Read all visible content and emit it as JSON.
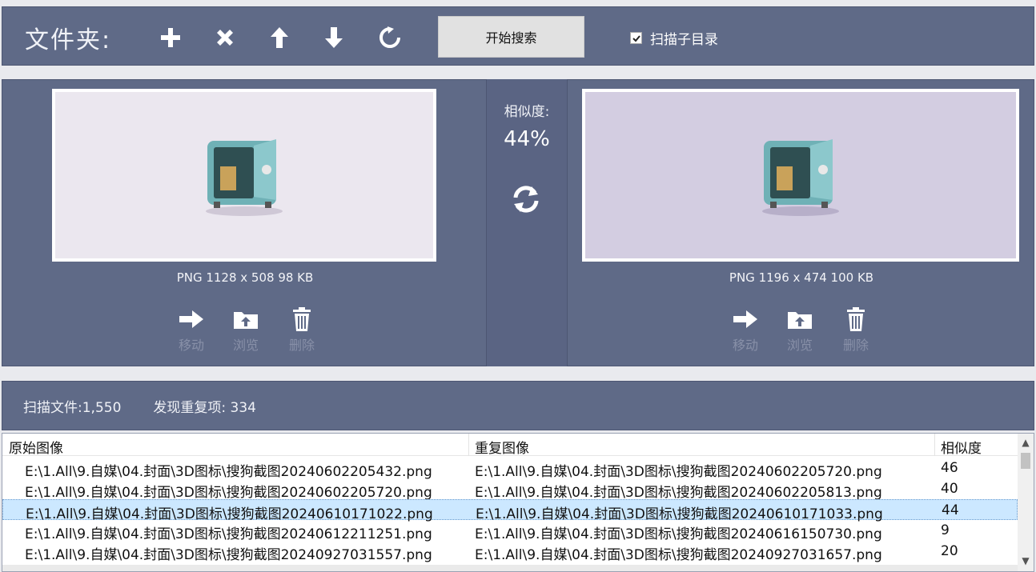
{
  "toolbar": {
    "folder_label": "文件夹:",
    "start_search_label": "开始搜索",
    "scan_subdir_label": "扫描子目录",
    "scan_subdir_checked": true,
    "icons": [
      "plus-icon",
      "close-icon",
      "arrow-up-icon",
      "arrow-down-icon",
      "refresh-icon"
    ]
  },
  "left_image": {
    "meta": "PNG  1128 x 508  98 KB",
    "actions": [
      "移动",
      "浏览",
      "删除"
    ]
  },
  "right_image": {
    "meta": "PNG  1196 x 474  100 KB",
    "actions": [
      "移动",
      "浏览",
      "删除"
    ]
  },
  "similarity": {
    "label": "相似度:",
    "value": "44%"
  },
  "stats": {
    "scanned_label": "扫描文件:1,550",
    "duplicates_label": "发现重复项: 334"
  },
  "table": {
    "headers": [
      "原始图像",
      "重复图像",
      "相似度"
    ],
    "rows": [
      {
        "original": "E:\\1.All\\9.自媒\\04.封面\\3D图标\\搜狗截图20240602205432.png",
        "duplicate": "E:\\1.All\\9.自媒\\04.封面\\3D图标\\搜狗截图20240602205720.png",
        "similarity": "46"
      },
      {
        "original": "E:\\1.All\\9.自媒\\04.封面\\3D图标\\搜狗截图20240602205720.png",
        "duplicate": "E:\\1.All\\9.自媒\\04.封面\\3D图标\\搜狗截图20240602205813.png",
        "similarity": "40"
      },
      {
        "original": "E:\\1.All\\9.自媒\\04.封面\\3D图标\\搜狗截图20240610171022.png",
        "duplicate": "E:\\1.All\\9.自媒\\04.封面\\3D图标\\搜狗截图20240610171033.png",
        "similarity": "44"
      },
      {
        "original": "E:\\1.All\\9.自媒\\04.封面\\3D图标\\搜狗截图20240612211251.png",
        "duplicate": "E:\\1.All\\9.自媒\\04.封面\\3D图标\\搜狗截图20240616150730.png",
        "similarity": "9"
      },
      {
        "original": "E:\\1.All\\9.自媒\\04.封面\\3D图标\\搜狗截图20240927031557.png",
        "duplicate": "E:\\1.All\\9.自媒\\04.封面\\3D图标\\搜狗截图20240927031657.png",
        "similarity": "20"
      }
    ],
    "selected_row": 2
  },
  "colors": {
    "panel": "#5f6a87",
    "selected_row": "#cce8ff",
    "left_bg": "#ebe7ef",
    "right_bg": "#d3cde1"
  }
}
